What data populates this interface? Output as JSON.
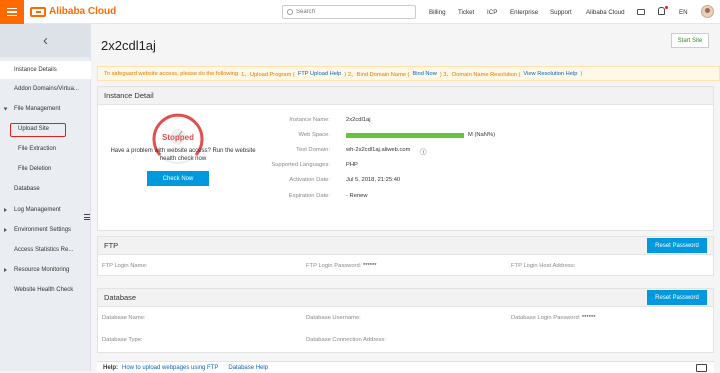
{
  "topbar": {
    "brand": "Alibaba Cloud",
    "search_placeholder": "Search",
    "nav": [
      "Billing",
      "Ticket",
      "ICP",
      "Enterprise",
      "Support",
      "Alibaba Cloud"
    ],
    "lang": "EN"
  },
  "sidebar": {
    "items": [
      {
        "label": "Instance Details"
      },
      {
        "label": "Addon Domains/Virtua..."
      },
      {
        "label": "File Management"
      },
      {
        "label": "Upload Site"
      },
      {
        "label": "File Extraction"
      },
      {
        "label": "File Deletion"
      },
      {
        "label": "Database"
      },
      {
        "label": "Log Management"
      },
      {
        "label": "Environment Settings"
      },
      {
        "label": "Access Statistics Re..."
      },
      {
        "label": "Resource Monitoring"
      },
      {
        "label": "Website Health Check"
      }
    ]
  },
  "main": {
    "title": "2x2cdl1aj",
    "start_button": "Start Site",
    "notice": {
      "intro": "To safeguard website access, please do the following",
      "step1": "1、Upload Program (",
      "step1_link": "FTP Upload Help",
      "step2": ")   2、Bind Domain Name (",
      "step2_link": "Bind Now",
      "step3": ")   3、Domain Name Resolution (",
      "step3_link": "View Resolution Help",
      "close": ")"
    },
    "instance": {
      "heading": "Instance Detail",
      "status": "Stopped",
      "help_text": "Have a problem with website access? Run the website health check now",
      "check_button": "Check Now",
      "labels": {
        "name": "Instance Name:",
        "space": "Web Space:",
        "test_domain": "Test Domain:",
        "languages": "Supported Languages:",
        "activation": "Activation Date:",
        "expiration": "Expiration Date:"
      },
      "values": {
        "name": "2x2cdl1aj",
        "space_text": "M (NaN%)",
        "space_fraction": 1.0,
        "test_domain": "wh-2x2cdl1aj.aliweb.com",
        "languages": "PHP",
        "activation": "Jul 5, 2018, 21:25:40",
        "expiration": "- Renew"
      }
    },
    "ftp": {
      "heading": "FTP",
      "reset_button": "Reset Password",
      "login_name": "FTP Login Name:",
      "login_password": "FTP Login Password:",
      "login_password_value": "******",
      "host_address": "FTP Login Host Address:"
    },
    "database": {
      "heading": "Database",
      "reset_button": "Reset Password",
      "name": "Database Name:",
      "username": "Database Username:",
      "login_password": "Database Login Password:",
      "login_password_value": "******",
      "type": "Database Type:",
      "connection": "Database Connection Address:"
    },
    "footer": {
      "help_label": "Help:",
      "link1": "How to upload webpages using FTP",
      "link2": "Database Help"
    }
  }
}
